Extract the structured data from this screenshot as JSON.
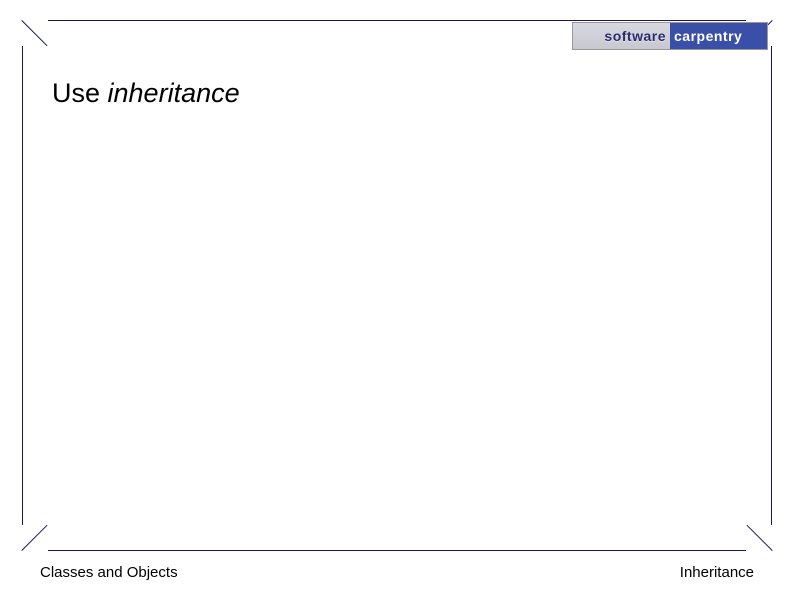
{
  "logo": {
    "left": "software",
    "right": "carpentry"
  },
  "heading": {
    "prefix": "Use ",
    "emphasis": "inheritance"
  },
  "footer": {
    "left": "Classes and Objects",
    "right": "Inheritance"
  }
}
